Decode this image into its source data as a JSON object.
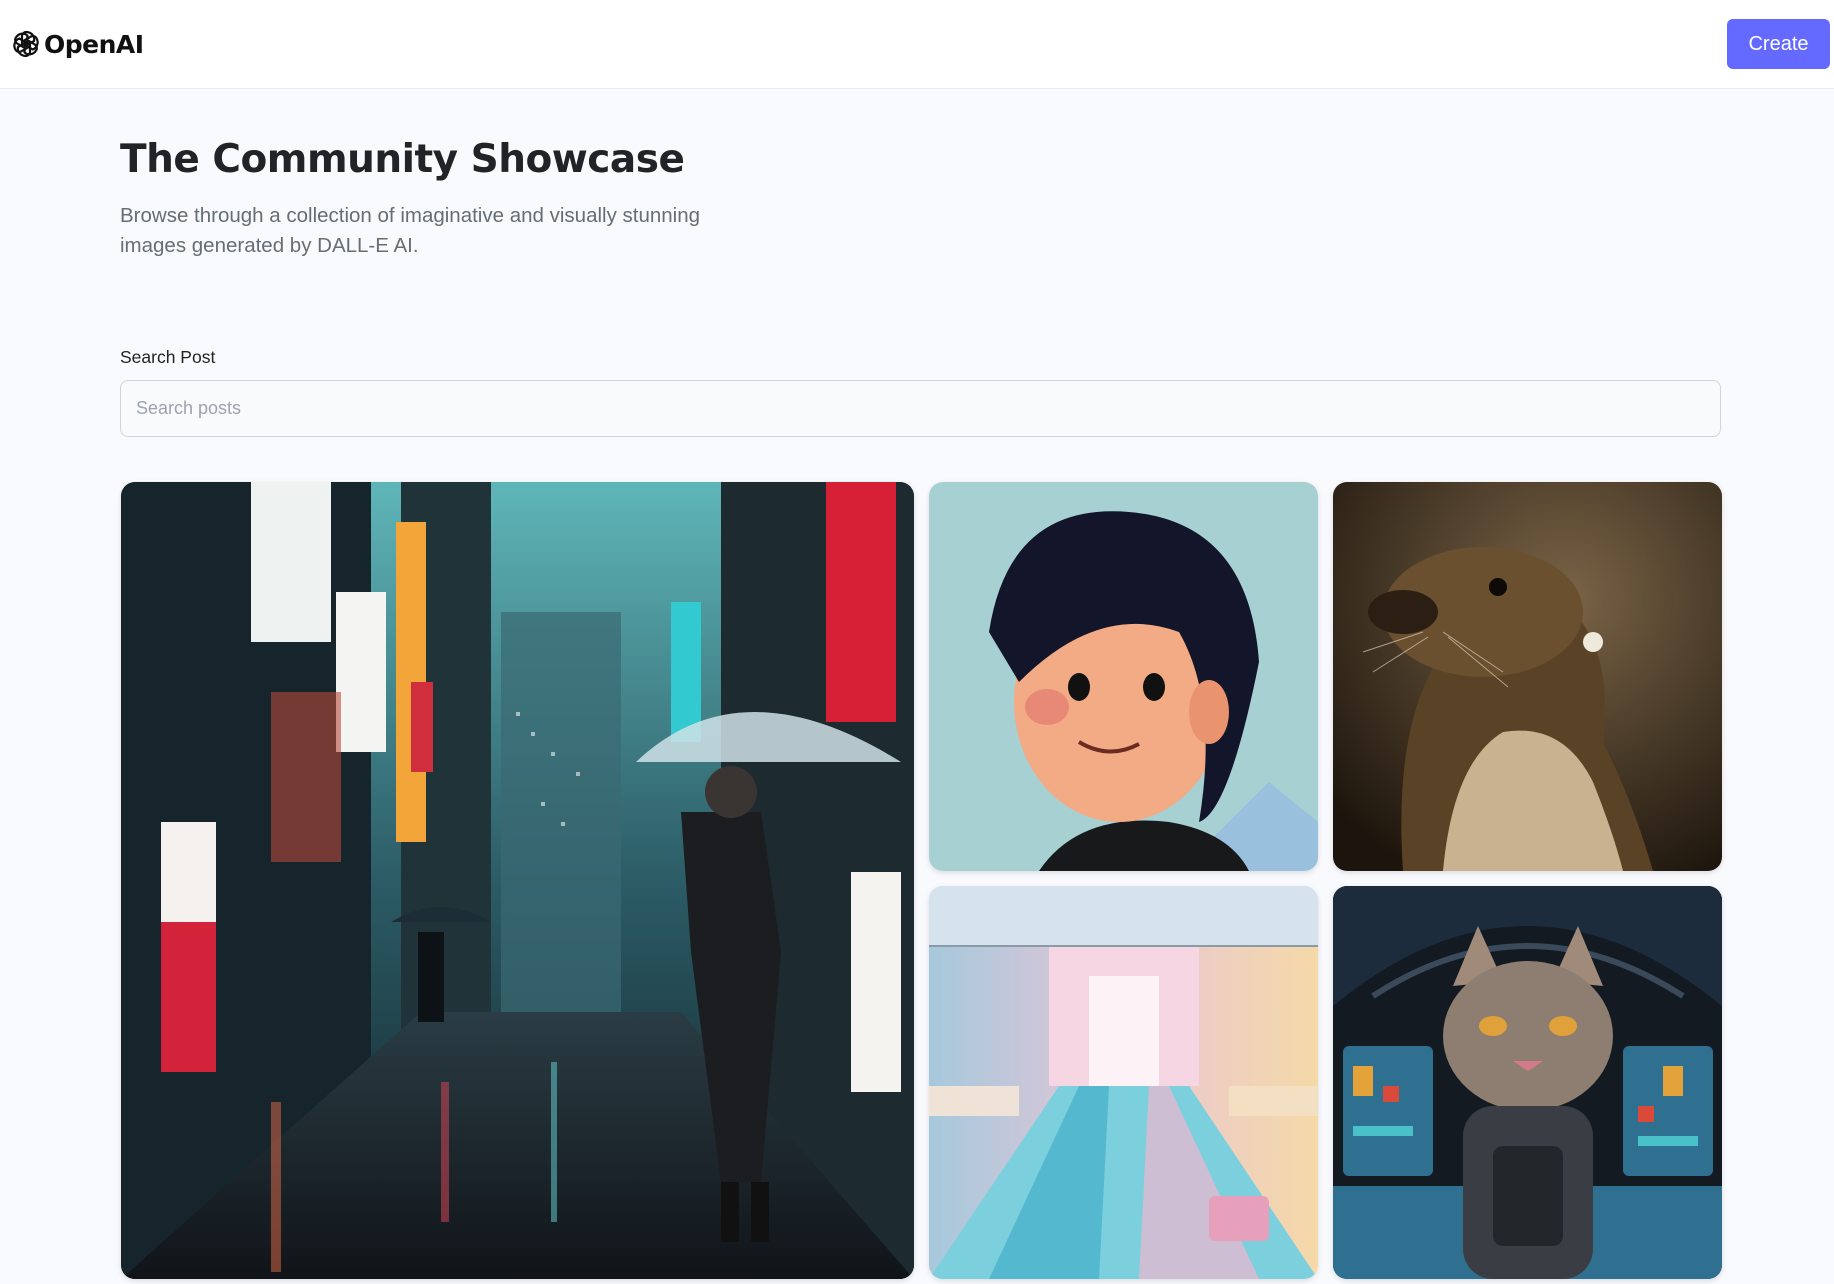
{
  "header": {
    "brand": "OpenAI",
    "create_label": "Create",
    "accent_color": "#6469ff"
  },
  "hero": {
    "title": "The Community Showcase",
    "subtitle": "Browse through a collection of imaginative and visually stunning images generated by DALL-E AI."
  },
  "search": {
    "label": "Search Post",
    "placeholder": "Search posts",
    "value": ""
  }
}
